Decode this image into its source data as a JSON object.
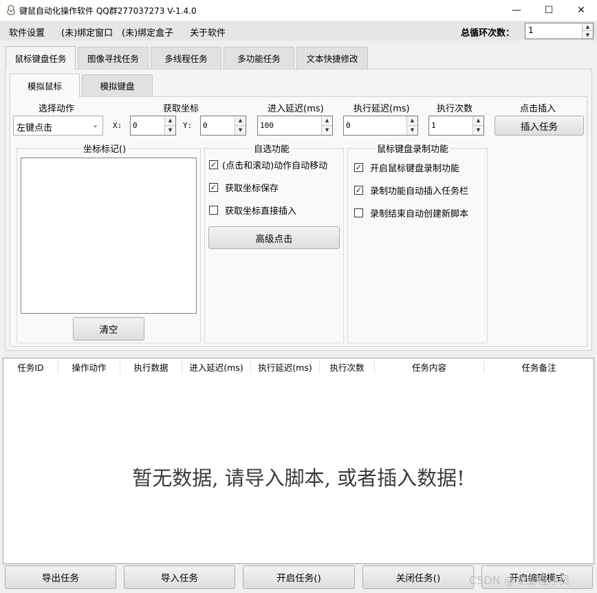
{
  "window": {
    "title": "键鼠自动化操作软件 QQ群277037273 V-1.4.0",
    "minimize_glyph": "—",
    "maximize_glyph": "☐",
    "close_glyph": "✕"
  },
  "menu": {
    "items": [
      "软件设置",
      "(未)绑定窗口",
      "(未)绑定盒子",
      "关于软件"
    ],
    "loop_label": "总循环次数：",
    "loop_value": "1"
  },
  "main_tabs": [
    "鼠标键盘任务",
    "图像寻找任务",
    "多线程任务",
    "多功能任务",
    "文本快捷修改"
  ],
  "sub_tabs": [
    "模拟鼠标",
    "模拟键盘"
  ],
  "controls": {
    "action_label": "选择动作",
    "action_value": "左键点击",
    "coord_label": "获取坐标",
    "x_label": "X:",
    "x_value": "0",
    "y_label": "Y:",
    "y_value": "0",
    "enter_delay_label": "进入延迟(ms)",
    "enter_delay_value": "100",
    "exec_delay_label": "执行延迟(ms)",
    "exec_delay_value": "0",
    "exec_count_label": "执行次数",
    "exec_count_value": "1",
    "insert_label": "点击插入",
    "insert_button": "插入任务"
  },
  "coord_group": {
    "title": "坐标标记()",
    "clear_button": "清空"
  },
  "options_group": {
    "title": "自选功能",
    "items": [
      {
        "label": "(点击和滚动)动作自动移动",
        "checked": true
      },
      {
        "label": "获取坐标保存",
        "checked": true
      },
      {
        "label": "获取坐标直接插入",
        "checked": false
      }
    ],
    "advanced_button": "高级点击"
  },
  "record_group": {
    "title": "鼠标键盘录制功能",
    "items": [
      {
        "label": "开启鼠标键盘录制功能",
        "checked": true
      },
      {
        "label": "录制功能自动插入任务栏",
        "checked": true
      },
      {
        "label": "录制结束自动创建新脚本",
        "checked": false
      }
    ]
  },
  "table": {
    "columns": [
      "任务ID",
      "操作动作",
      "执行数据",
      "进入延迟(ms)",
      "执行延迟(ms)",
      "执行次数",
      "任务内容",
      "任务备注"
    ],
    "empty_message": "暂无数据, 请导入脚本, 或者插入数据!"
  },
  "bottom_buttons": [
    "导出任务",
    "导入任务",
    "开启任务()",
    "关闭任务()",
    "开启编辑模式"
  ],
  "watermark": "CSDN @专业程序员",
  "icons": {
    "check": "✓",
    "chevron_down": "⌄",
    "spin_up": "▲",
    "spin_down": "▼"
  }
}
